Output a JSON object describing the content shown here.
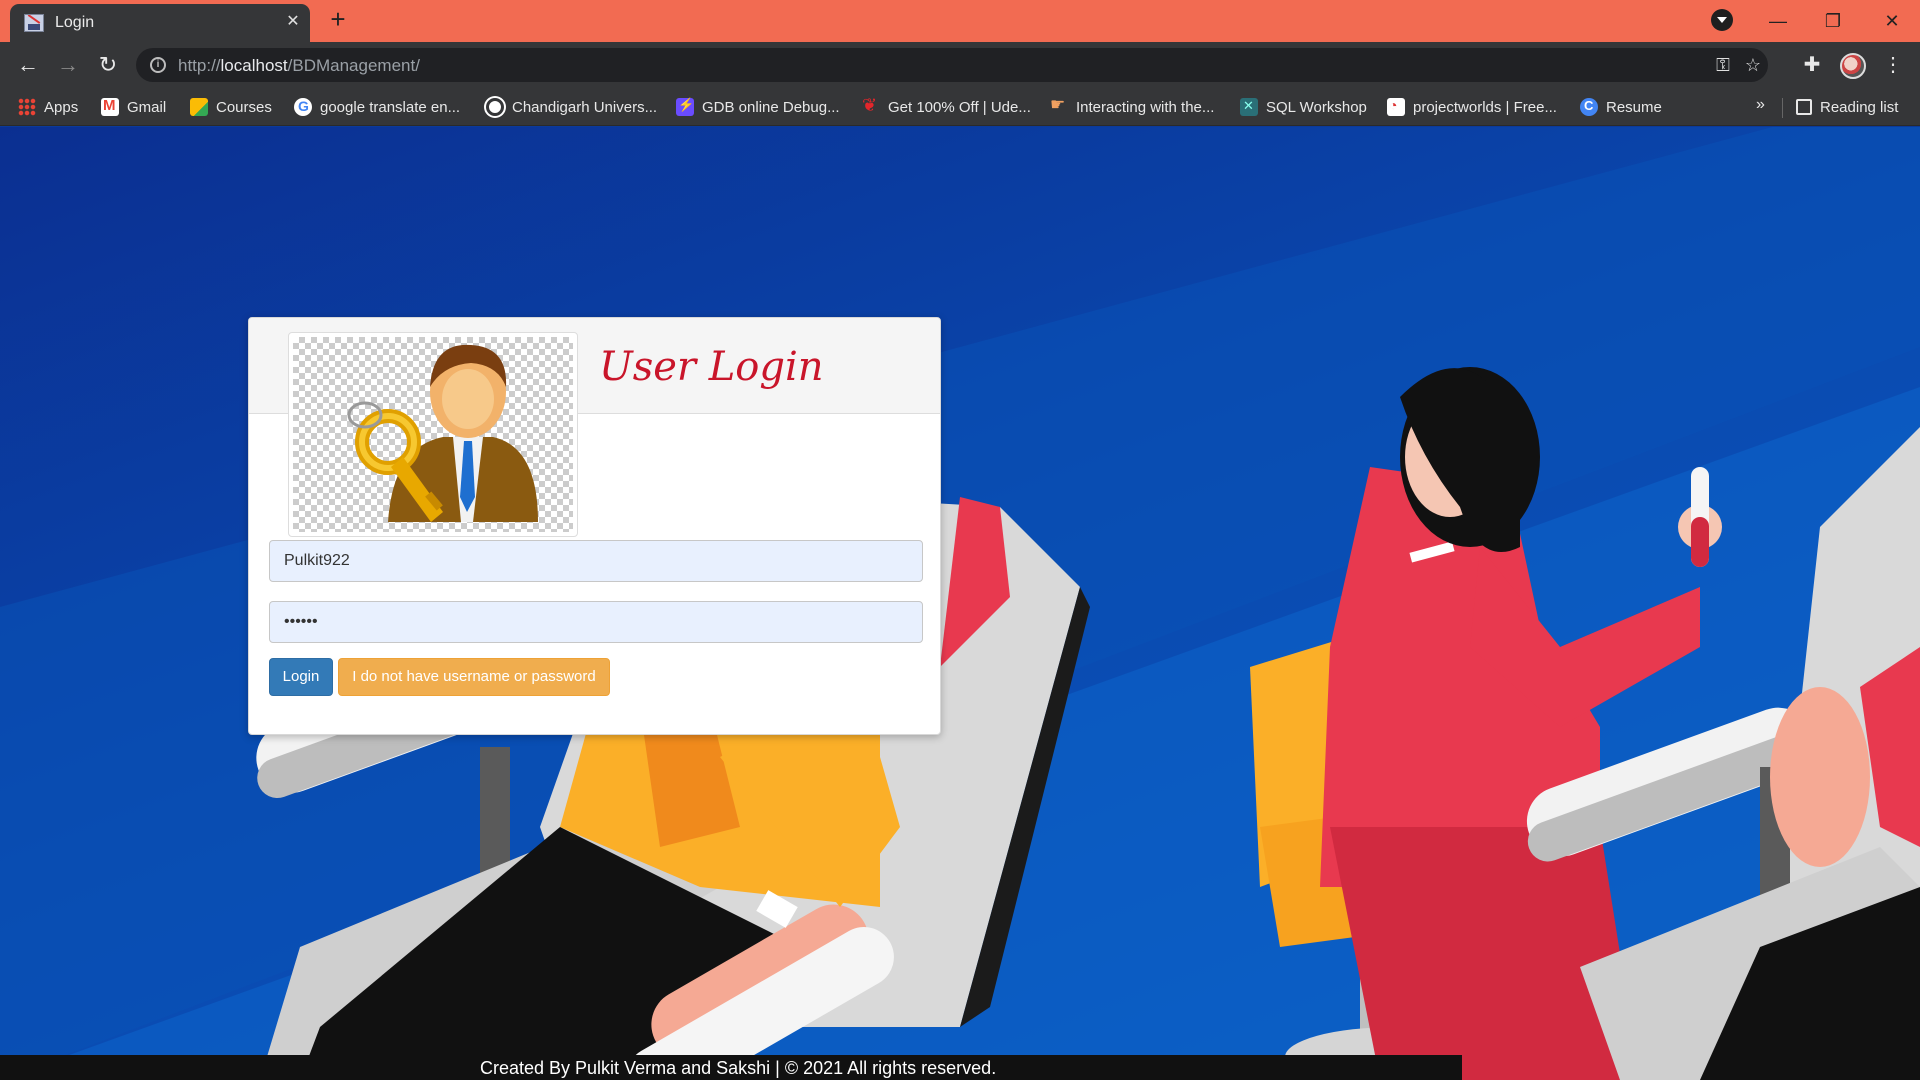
{
  "browser": {
    "tab_title": "Login",
    "tab_close": "✕",
    "new_tab": "+",
    "url_scheme": "http://",
    "url_host": "localhost",
    "url_path": "/BDManagement/",
    "window_controls": {
      "minimize": "—",
      "restore": "❐",
      "close": "✕"
    },
    "toolbar_icons": {
      "back": "←",
      "forward": "→",
      "reload": "↻",
      "key": "⚿",
      "star": "☆",
      "extensions": "✚",
      "menu": "⋮"
    }
  },
  "bookmarks": {
    "items": [
      {
        "label": "Apps",
        "icon": "apps-grid-icon"
      },
      {
        "label": "Gmail",
        "icon": "gmail-icon"
      },
      {
        "label": "Courses",
        "icon": "courses-icon"
      },
      {
        "label": "google translate en...",
        "icon": "google-icon"
      },
      {
        "label": "Chandigarh Univers...",
        "icon": "globe-icon"
      },
      {
        "label": "GDB online Debug...",
        "icon": "gdb-icon"
      },
      {
        "label": "Get 100% Off | Ude...",
        "icon": "udemy-icon"
      },
      {
        "label": "Interacting with the...",
        "icon": "hand-icon"
      },
      {
        "label": "SQL Workshop",
        "icon": "sql-icon"
      },
      {
        "label": "projectworlds | Free...",
        "icon": "projectworlds-icon"
      },
      {
        "label": "Resume",
        "icon": "resume-icon"
      }
    ],
    "more": "»",
    "reading_list": "Reading list"
  },
  "login": {
    "title": "User Login",
    "username_value": "Pulkit922",
    "password_value": "••••••",
    "login_button": "Login",
    "help_button": "I do not have username or password"
  },
  "footer": {
    "text": "Created By Pulkit Verma and Sakshi | © 2021 All rights reserved."
  },
  "colors": {
    "tabstrip": "#f26b52",
    "toolbar": "#353638",
    "title_red": "#c9152a",
    "login_blue": "#337ab7",
    "help_orange": "#f0ad4e"
  }
}
